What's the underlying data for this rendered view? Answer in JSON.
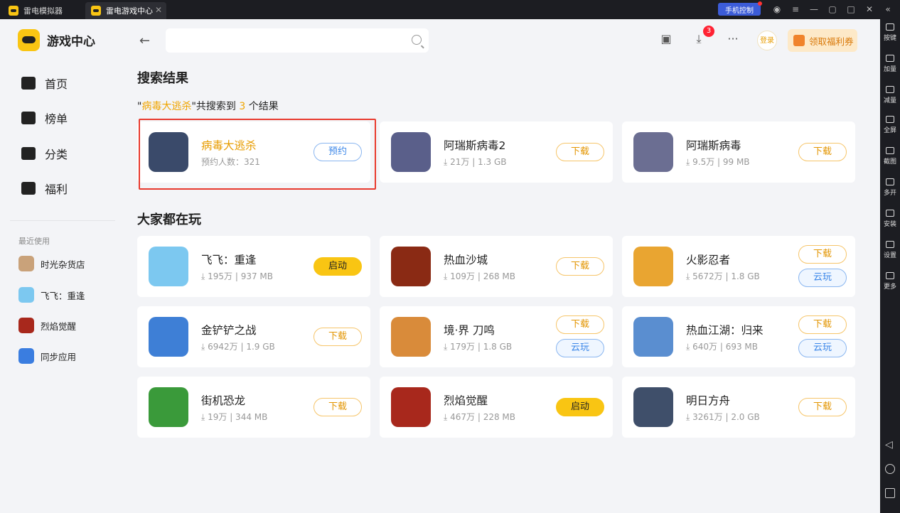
{
  "titlebar": {
    "tab1": "雷电模拟器",
    "tab2": "雷电游戏中心",
    "phone_control": "手机控制"
  },
  "right_toolbar": [
    {
      "label": "按键"
    },
    {
      "label": "加量"
    },
    {
      "label": "减量"
    },
    {
      "label": "全屏"
    },
    {
      "label": "截图"
    },
    {
      "label": "多开"
    },
    {
      "label": "安装"
    },
    {
      "label": "设置"
    },
    {
      "label": "更多"
    }
  ],
  "sidebar": {
    "brand": "游戏中心",
    "nav": [
      "首页",
      "榜单",
      "分类",
      "福利"
    ],
    "recent_title": "最近使用",
    "recent": [
      "时光杂货店",
      "飞飞：重逢",
      "烈焰觉醒",
      "同步应用"
    ]
  },
  "header": {
    "search_placeholder": "",
    "download_badge": "3",
    "login": "登录",
    "coupon": "领取福利券"
  },
  "search": {
    "title": "搜索结果",
    "count_prefix": "\"",
    "keyword": "病毒大逃杀",
    "count_mid": "\"共搜索到 ",
    "count_num": "3",
    "count_suffix": " 个结果",
    "results": [
      {
        "name": "病毒大逃杀",
        "meta": "预约人数：321",
        "button": "预约",
        "color": "#3a4a6a"
      },
      {
        "name": "阿瑞斯病毒2",
        "meta": "⤓ 21万 | 1.3 GB",
        "button": "下载",
        "color": "#5a5f8a"
      },
      {
        "name": "阿瑞斯病毒",
        "meta": "⤓ 9.5万 | 99 MB",
        "button": "下载",
        "color": "#6b6e92"
      }
    ]
  },
  "popular": {
    "title": "大家都在玩",
    "items": [
      {
        "name": "飞飞：重逢",
        "meta": "⤓ 195万 | 937 MB",
        "buttons": [
          "启动"
        ],
        "color": "#7cc8f0"
      },
      {
        "name": "热血沙城",
        "meta": "⤓ 109万 | 268 MB",
        "buttons": [
          "下载"
        ],
        "color": "#8a2a14"
      },
      {
        "name": "火影忍者",
        "meta": "⤓ 5672万 | 1.8 GB",
        "buttons": [
          "下载",
          "云玩"
        ],
        "color": "#e9a531"
      },
      {
        "name": "金铲铲之战",
        "meta": "⤓ 6942万 | 1.9 GB",
        "buttons": [
          "下载"
        ],
        "color": "#3e7fd6"
      },
      {
        "name": "境·界 刀鸣",
        "meta": "⤓ 179万 | 1.8 GB",
        "buttons": [
          "下载",
          "云玩"
        ],
        "color": "#d98b3a"
      },
      {
        "name": "热血江湖：归来",
        "meta": "⤓ 640万 | 693 MB",
        "buttons": [
          "下载",
          "云玩"
        ],
        "color": "#5a8ed0"
      },
      {
        "name": "街机恐龙",
        "meta": "⤓ 19万 | 344 MB",
        "buttons": [
          "下载"
        ],
        "color": "#3a9a3a"
      },
      {
        "name": "烈焰觉醒",
        "meta": "⤓ 467万 | 228 MB",
        "buttons": [
          "启动"
        ],
        "color": "#a8281c"
      },
      {
        "name": "明日方舟",
        "meta": "⤓ 3261万 | 2.0 GB",
        "buttons": [
          "下载"
        ],
        "color": "#3f4f6a"
      }
    ]
  }
}
